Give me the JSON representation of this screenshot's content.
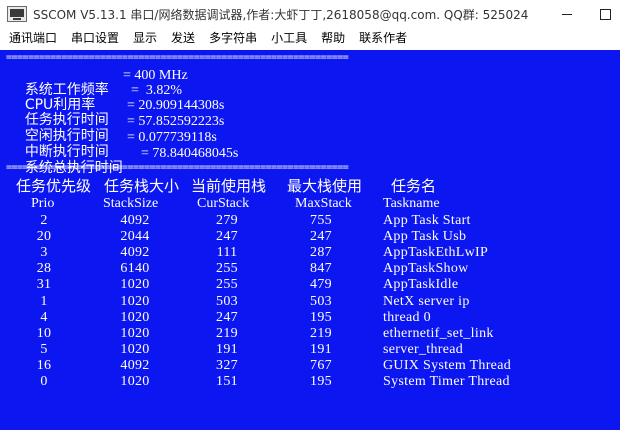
{
  "window": {
    "title": "SSCOM V5.13.1 串口/网络数据调试器,作者:大虾丁丁,2618058@qq.com. QQ群: 525024..."
  },
  "menu": [
    "通讯端口",
    "串口设置",
    "显示",
    "发送",
    "多字符串",
    "小工具",
    "帮助",
    "联系作者"
  ],
  "terminal": {
    "separator": "==============================================================",
    "stats": [
      {
        "label": "系统工作频率",
        "value": "= 400 MHz"
      },
      {
        "label": "CPU利用率",
        "value": "=  3.82%"
      },
      {
        "label": "任务执行时间",
        "value": "= 20.909144308s"
      },
      {
        "label": "空闲执行时间",
        "value": "= 57.852592223s"
      },
      {
        "label": "中断执行时间",
        "value": "= 0.077739118s"
      },
      {
        "label": "系统总执行时间",
        "value": "= 78.840468045s"
      }
    ],
    "table": {
      "cn_headers": [
        "任务优先级",
        "任务栈大小",
        "当前使用栈",
        "最大栈使用",
        "任务名"
      ],
      "en_headers": [
        "Prio",
        "StackSize",
        "CurStack",
        "MaxStack",
        "Taskname"
      ],
      "rows": [
        [
          "2",
          "4092",
          "279",
          "755",
          "App Task Start"
        ],
        [
          "20",
          "2044",
          "247",
          "247",
          "App Task Usb"
        ],
        [
          "3",
          "4092",
          "111",
          "287",
          "AppTaskEthLwIP"
        ],
        [
          "28",
          "6140",
          "255",
          "847",
          "AppTaskShow"
        ],
        [
          "31",
          "1020",
          "255",
          "479",
          "AppTaskIdle"
        ],
        [
          "1",
          "1020",
          "503",
          "503",
          "NetX server ip"
        ],
        [
          "4",
          "1020",
          "247",
          "195",
          "thread 0"
        ],
        [
          "10",
          "1020",
          "219",
          "219",
          "ethernetif_set_link"
        ],
        [
          "5",
          "1020",
          "191",
          "191",
          "server_thread"
        ],
        [
          "16",
          "4092",
          "327",
          "767",
          "GUIX System Thread"
        ],
        [
          "0",
          "1020",
          "151",
          "195",
          "System Timer Thread"
        ]
      ]
    }
  },
  "colors": {
    "terminal_bg": "#0b16f0",
    "terminal_fg": "#ffffff"
  }
}
